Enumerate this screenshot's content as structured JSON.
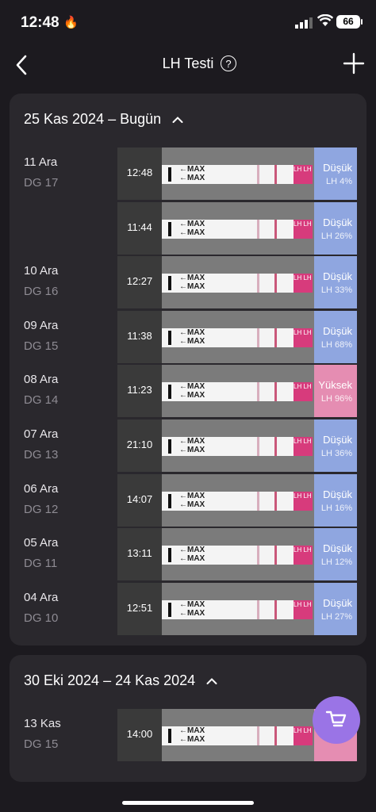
{
  "status": {
    "time": "12:48",
    "battery": "66"
  },
  "nav": {
    "title": "LH Testi",
    "help": "?"
  },
  "sections": [
    {
      "header": "25 Kas 2024 – Bugün",
      "entries": [
        {
          "day": "11 Ara",
          "dg": "DG 17",
          "time": "12:48",
          "level": "Düşük",
          "lh": "LH 4%"
        },
        {
          "day": "",
          "dg": "",
          "time": "11:44",
          "level": "Düşük",
          "lh": "LH 26%"
        },
        {
          "day": "10 Ara",
          "dg": "DG 16",
          "time": "12:27",
          "level": "Düşük",
          "lh": "LH 33%"
        },
        {
          "day": "09 Ara",
          "dg": "DG 15",
          "time": "11:38",
          "level": "Düşük",
          "lh": "LH 68%"
        },
        {
          "day": "08 Ara",
          "dg": "DG 14",
          "time": "11:23",
          "level": "Yüksek",
          "lh": "LH 96%"
        },
        {
          "day": "07 Ara",
          "dg": "DG 13",
          "time": "21:10",
          "level": "Düşük",
          "lh": "LH 36%"
        },
        {
          "day": "06 Ara",
          "dg": "DG 12",
          "time": "14:07",
          "level": "Düşük",
          "lh": "LH 16%"
        },
        {
          "day": "05 Ara",
          "dg": "DG 11",
          "time": "13:11",
          "level": "Düşük",
          "lh": "LH 12%"
        },
        {
          "day": "04 Ara",
          "dg": "DG 10",
          "time": "12:51",
          "level": "Düşük",
          "lh": "LH 27%"
        }
      ]
    },
    {
      "header": "30 Eki 2024 – 24 Kas 2024",
      "entries": [
        {
          "day": "13 Kas",
          "dg": "DG 15",
          "time": "14:00",
          "level": "",
          "lh": ""
        }
      ]
    }
  ],
  "strip_text": {
    "max": "MAX",
    "lh": "LH LH"
  },
  "colors": {
    "low": "#8fa6e0",
    "high": "#e58db2",
    "accent": "#9a74e6",
    "background": "#1c1a1f"
  },
  "icons": {
    "back": "chevron-left-icon",
    "help": "question-circle-icon",
    "add": "plus-icon",
    "collapse": "chevron-up-icon",
    "cart": "cart-icon"
  }
}
